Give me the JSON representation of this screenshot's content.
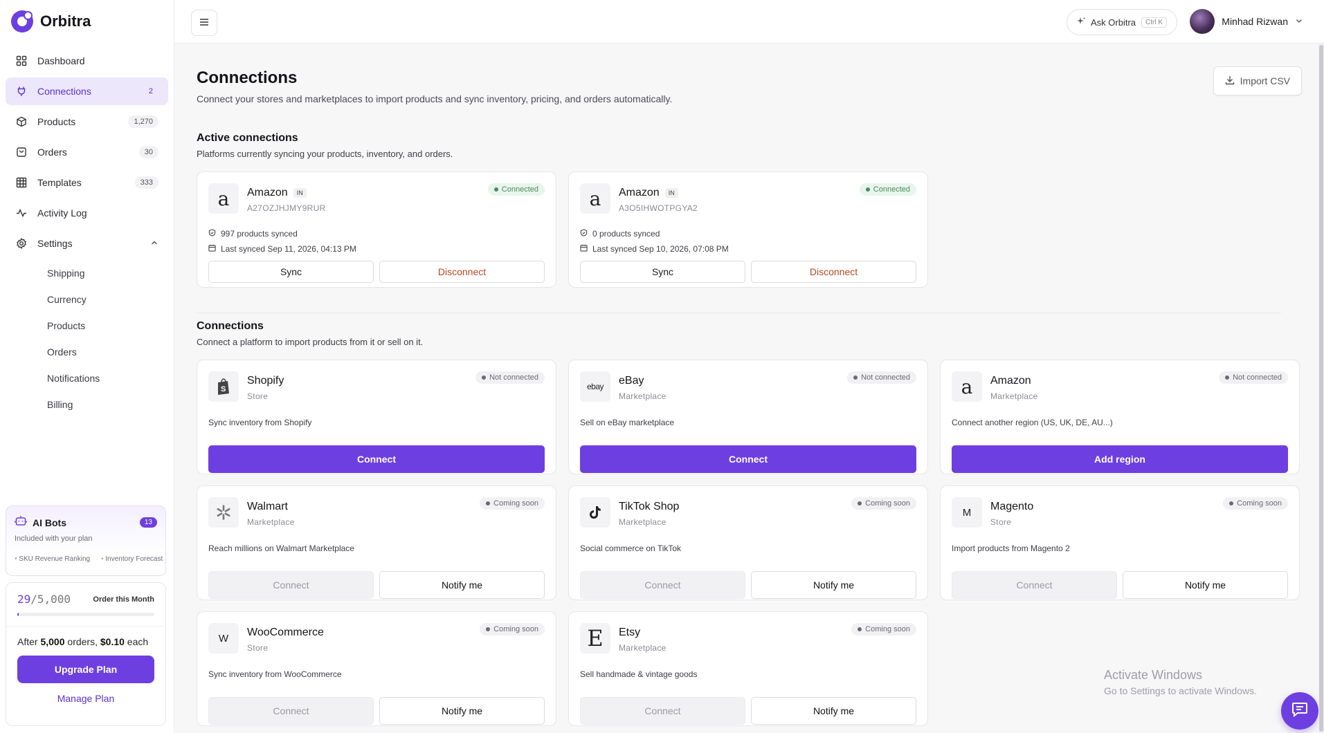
{
  "brand": {
    "name": "Orbitra"
  },
  "sidebar": {
    "items": [
      {
        "label": "Dashboard",
        "count": "",
        "icon": "grid-icon"
      },
      {
        "label": "Connections",
        "count": "2",
        "icon": "plug-icon"
      },
      {
        "label": "Products",
        "count": "1,270",
        "icon": "box-icon"
      },
      {
        "label": "Orders",
        "count": "30",
        "icon": "bag-icon"
      },
      {
        "label": "Templates",
        "count": "333",
        "icon": "table-icon"
      },
      {
        "label": "Activity Log",
        "count": "",
        "icon": "activity-icon"
      },
      {
        "label": "Settings",
        "count": "",
        "icon": "gear-icon"
      }
    ],
    "settings_sub": [
      "Shipping",
      "Currency",
      "Products",
      "Orders",
      "Notifications",
      "Billing"
    ]
  },
  "ai_bots": {
    "title": "AI Bots",
    "badge": "13",
    "subtitle": "Included with your plan",
    "ticker": [
      "SKU Revenue Ranking",
      "Inventory Forecast"
    ]
  },
  "usage": {
    "used": "29",
    "total": "/5,000",
    "label": "Order this Month",
    "progress": 0.0058,
    "note_prefix": "After ",
    "note_orders": "5,000",
    "note_mid": " orders, ",
    "note_price": "$0.10",
    "note_suffix": " each",
    "upgrade_label": "Upgrade Plan",
    "manage_label": "Manage Plan"
  },
  "topbar": {
    "ask_label": "Ask Orbitra",
    "ask_shortcut": "Ctrl K",
    "user_name": "Minhad Rizwan"
  },
  "page": {
    "title": "Connections",
    "subtitle": "Connect your stores and marketplaces to import products and sync inventory, pricing, and orders automatically.",
    "import_label": "Import CSV"
  },
  "active_section": {
    "title": "Active connections",
    "subtitle": "Platforms currently syncing your products, inventory, and orders.",
    "cards": [
      {
        "name": "Amazon",
        "region": "IN",
        "id": "A27OZJHJMY9RUR",
        "status": "Connected",
        "products": "997 products synced",
        "last_synced": "Last synced Sep 11, 2026, 04:13 PM",
        "sync_label": "Sync",
        "disconnect_label": "Disconnect"
      },
      {
        "name": "Amazon",
        "region": "IN",
        "id": "A3O5IHWOTPGYA2",
        "status": "Connected",
        "products": "0 products synced",
        "last_synced": "Last synced Sep 10, 2026, 07:08 PM",
        "sync_label": "Sync",
        "disconnect_label": "Disconnect"
      }
    ]
  },
  "connections_section": {
    "title": "Connections",
    "subtitle": "Connect a platform to import products from it or sell on it.",
    "available": [
      {
        "name": "Shopify",
        "type": "Store",
        "status": "Not connected",
        "desc": "Sync inventory from Shopify",
        "action": "Connect",
        "logo": "shopify-bag-icon"
      },
      {
        "name": "eBay",
        "type": "Marketplace",
        "status": "Not connected",
        "desc": "Sell on eBay marketplace",
        "action": "Connect",
        "logo": "ebay"
      },
      {
        "name": "Amazon",
        "type": "Marketplace",
        "status": "Not connected",
        "desc": "Connect another region (US, UK, DE, AU...)",
        "action": "Add region",
        "logo": "a"
      }
    ],
    "coming": [
      {
        "name": "Walmart",
        "type": "Marketplace",
        "status": "Coming soon",
        "desc": "Reach millions on Walmart Marketplace",
        "connect": "Connect",
        "notify": "Notify me",
        "logo": "walmart-spark-icon"
      },
      {
        "name": "TikTok Shop",
        "type": "Marketplace",
        "status": "Coming soon",
        "desc": "Social commerce on TikTok",
        "connect": "Connect",
        "notify": "Notify me",
        "logo": "tiktok-icon"
      },
      {
        "name": "Magento",
        "type": "Store",
        "status": "Coming soon",
        "desc": "Import products from Magento 2",
        "connect": "Connect",
        "notify": "Notify me",
        "logo": "M"
      },
      {
        "name": "WooCommerce",
        "type": "Store",
        "status": "Coming soon",
        "desc": "Sync inventory from WooCommerce",
        "connect": "Connect",
        "notify": "Notify me",
        "logo": "W"
      },
      {
        "name": "Etsy",
        "type": "Marketplace",
        "status": "Coming soon",
        "desc": "Sell handmade & vintage goods",
        "connect": "Connect",
        "notify": "Notify me",
        "logo": "E"
      }
    ]
  },
  "watermark": {
    "line1": "Activate Windows",
    "line2": "Go to Settings to activate Windows."
  },
  "colors": {
    "accent": "#6d3fe0",
    "connected": "#4c8a5d",
    "danger": "#b54a1f"
  }
}
